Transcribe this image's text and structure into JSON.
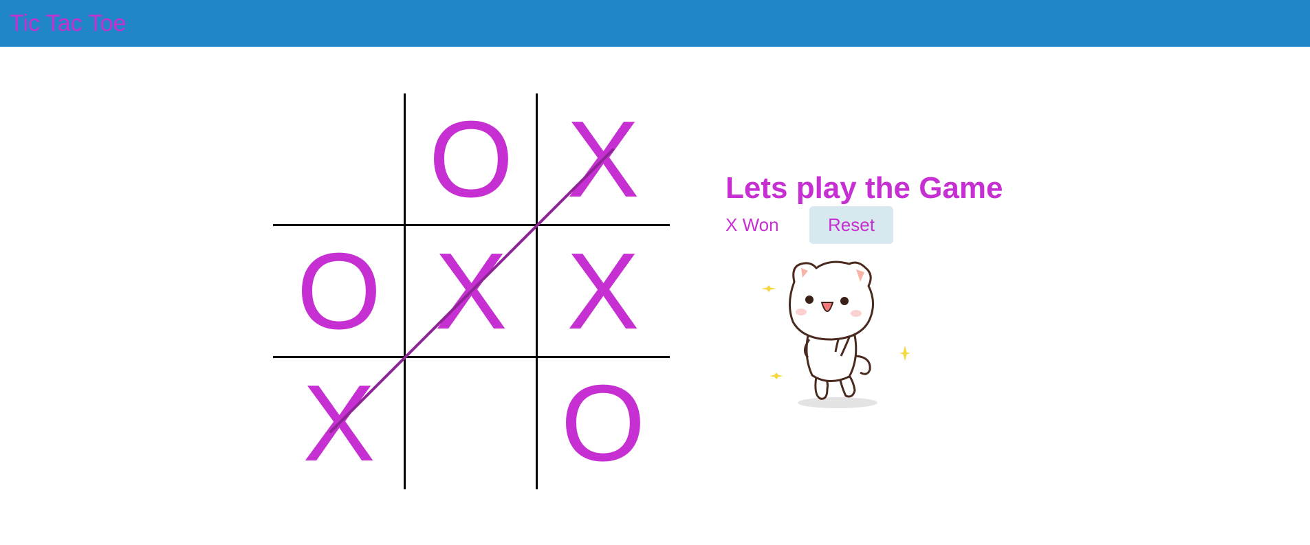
{
  "header": {
    "title": "Tic Tac Toe"
  },
  "board": {
    "cells": [
      "",
      "O",
      "X",
      "O",
      "X",
      "X",
      "X",
      "",
      "O"
    ],
    "winning_line": [
      6,
      4,
      2
    ]
  },
  "panel": {
    "title": "Lets play the Game",
    "status": "X Won",
    "reset_label": "Reset"
  },
  "colors": {
    "header_bg": "#2186c8",
    "accent": "#c62fd1",
    "win_line": "#8e2396",
    "button_bg": "#d8e8ef"
  },
  "illustration": {
    "icon": "dancing-cat-sticker"
  }
}
